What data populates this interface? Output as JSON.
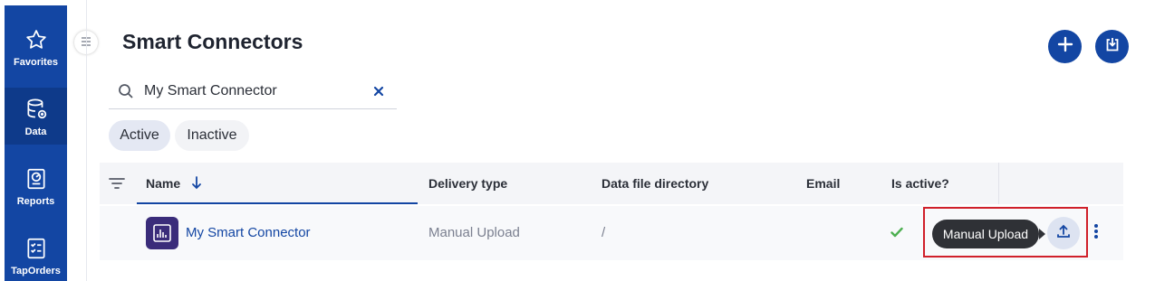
{
  "sidebar": {
    "items": [
      {
        "label": "Favorites",
        "icon": "star-icon"
      },
      {
        "label": "Data",
        "icon": "database-icon"
      },
      {
        "label": "Reports",
        "icon": "report-icon"
      },
      {
        "label": "TapOrders",
        "icon": "checklist-icon"
      }
    ],
    "active": "Data"
  },
  "page": {
    "title": "Smart Connectors"
  },
  "search": {
    "value": "My Smart Connector"
  },
  "filters": {
    "active_label": "Active",
    "inactive_label": "Inactive"
  },
  "table": {
    "columns": [
      "Name",
      "Delivery type",
      "Data file directory",
      "Email",
      "Is active?"
    ],
    "rows": [
      {
        "name": "My Smart Connector",
        "delivery_type": "Manual Upload",
        "data_file_directory": "/",
        "email": "",
        "is_active": true
      }
    ]
  },
  "tooltip": {
    "text": "Manual Upload"
  },
  "colors": {
    "brand": "#1346a3",
    "check": "#4caf50",
    "highlight": "#d0202a"
  }
}
